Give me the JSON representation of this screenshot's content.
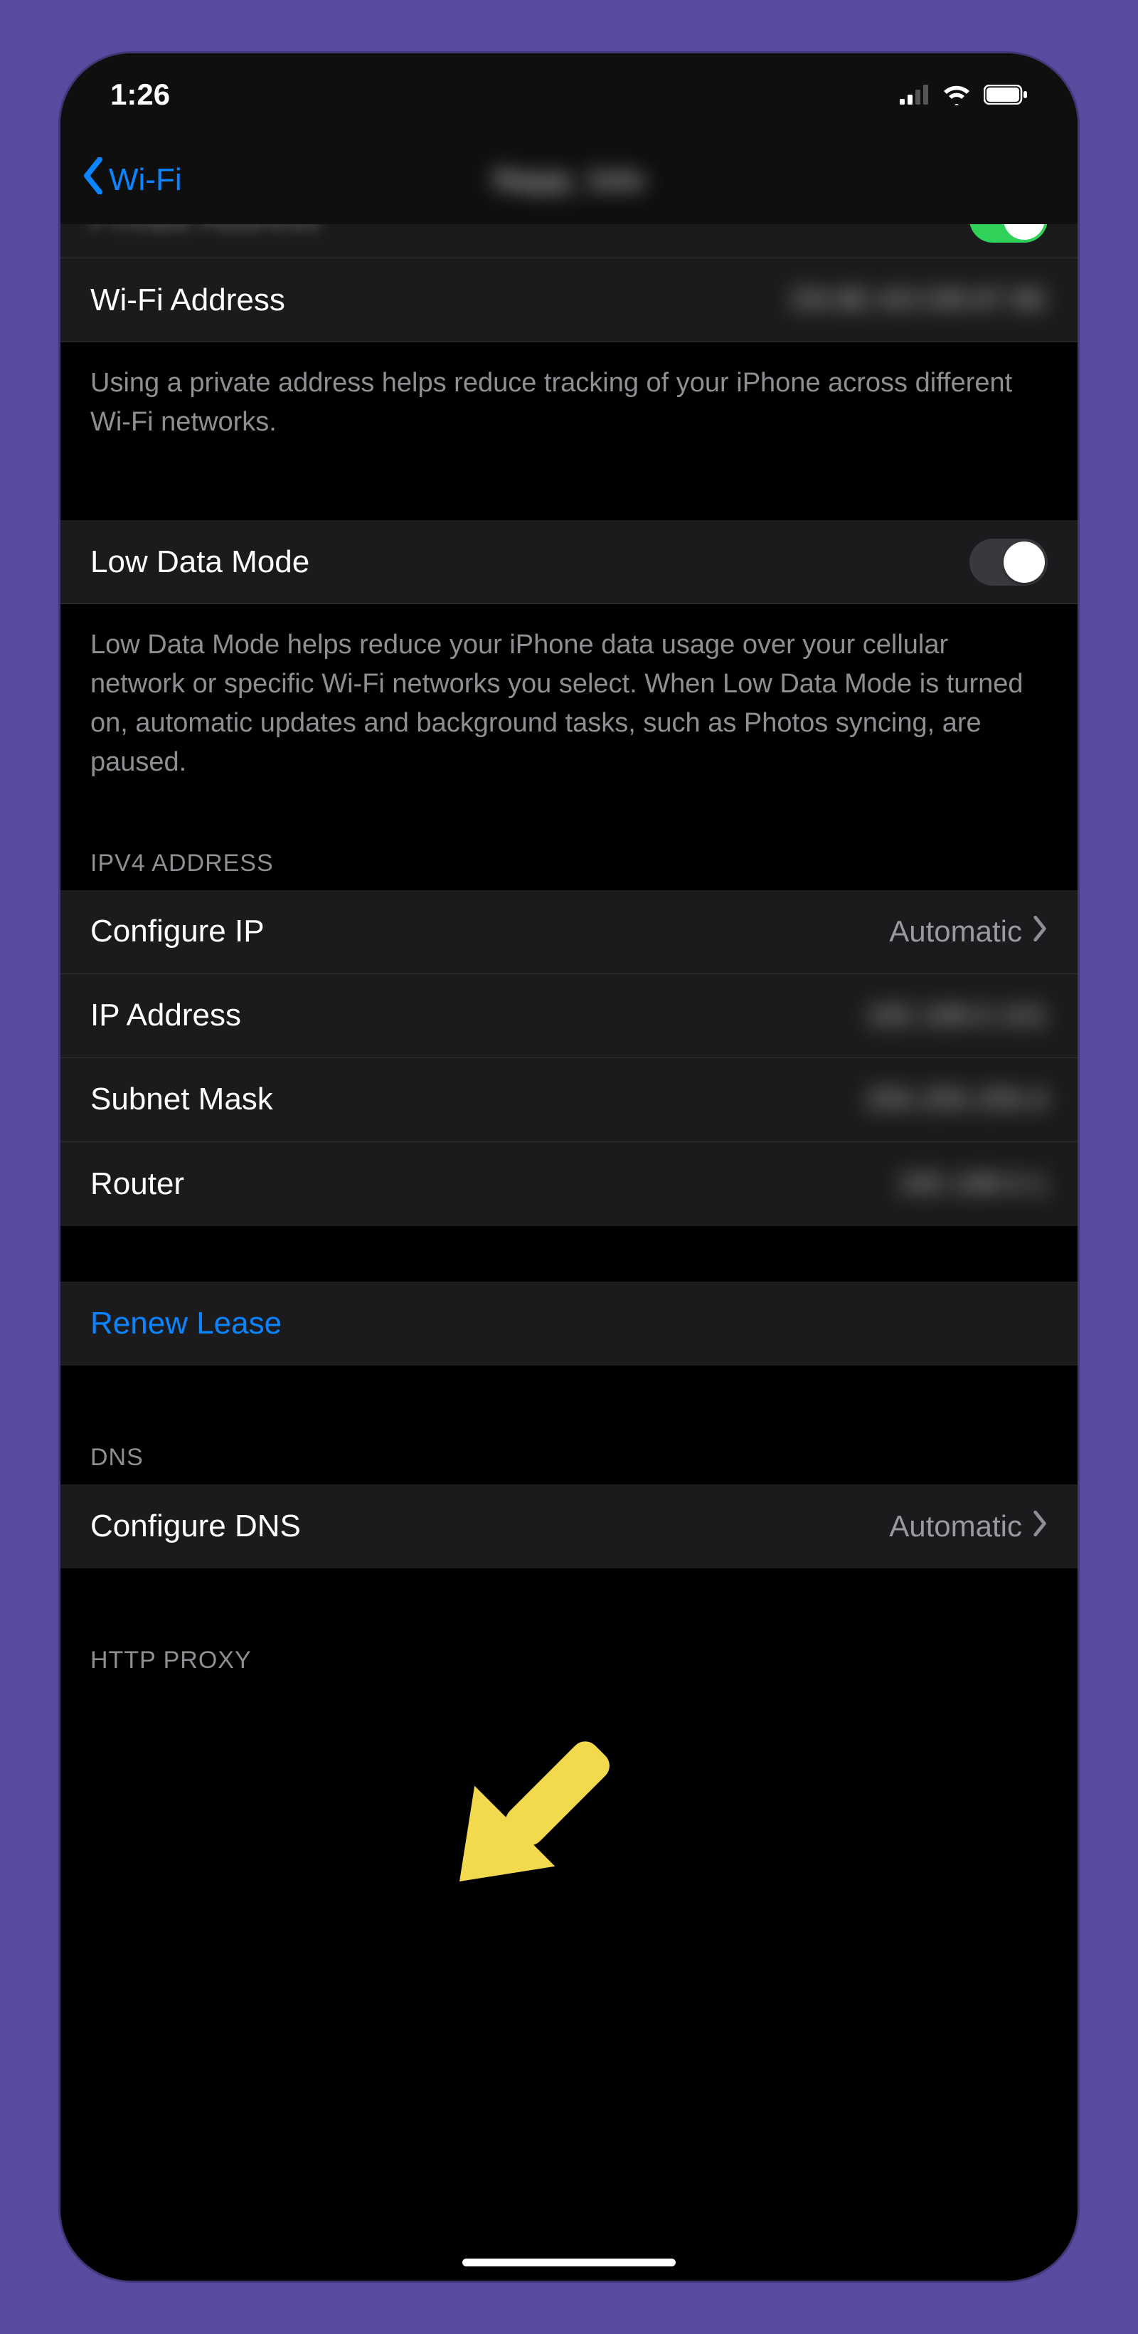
{
  "statusbar": {
    "time": "1:26"
  },
  "nav": {
    "back_label": "Wi-Fi",
    "title": "Napp_lolo"
  },
  "rows": {
    "private_address_label": "Private Address",
    "wifi_address_label": "Wi-Fi Address",
    "wifi_address_value": "D6:8E:AD:DB:87:9E",
    "private_footer": "Using a private address helps reduce tracking of your iPhone across different Wi-Fi networks.",
    "low_data_label": "Low Data Mode",
    "low_data_footer": "Low Data Mode helps reduce your iPhone data usage over your cellular network or specific Wi-Fi networks you select. When Low Data Mode is turned on, automatic updates and background tasks, such as Photos syncing, are paused."
  },
  "sections": {
    "ipv4_header": "IPV4 ADDRESS",
    "dns_header": "DNS",
    "http_header": "HTTP PROXY"
  },
  "ipv4": {
    "configure_label": "Configure IP",
    "configure_value": "Automatic",
    "ip_label": "IP Address",
    "ip_value": "192.168.0.101",
    "subnet_label": "Subnet Mask",
    "subnet_value": "255.255.255.0",
    "router_label": "Router",
    "router_value": "192.168.0.1"
  },
  "actions": {
    "renew_lease": "Renew Lease"
  },
  "dns": {
    "configure_label": "Configure DNS",
    "configure_value": "Automatic"
  },
  "colors": {
    "accent": "#0a84ff",
    "toggle_on": "#30d158",
    "annotation": "#f2d94e"
  }
}
